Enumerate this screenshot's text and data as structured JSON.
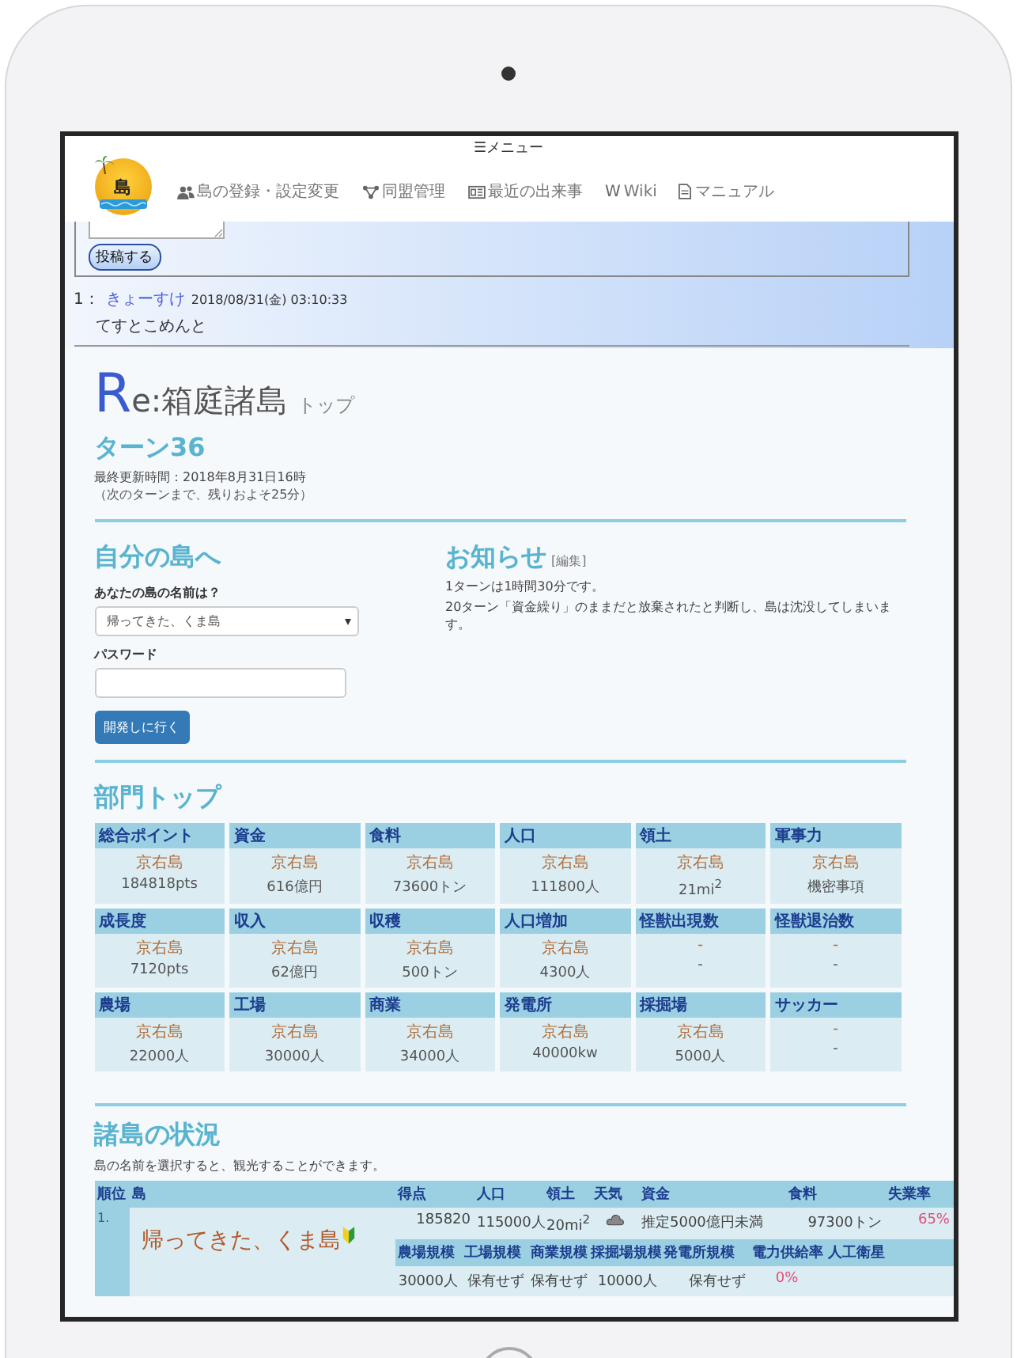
{
  "menu": {
    "icon": "☰",
    "label": "メニュー"
  },
  "logo": {
    "text": "島"
  },
  "nav": [
    {
      "kind": "users",
      "label": "島の登録・設定変更"
    },
    {
      "kind": "nodes",
      "label": "同盟管理"
    },
    {
      "kind": "news",
      "label": "最近の出来事"
    },
    {
      "kind": "letter",
      "glyph": "W",
      "label": "Wiki"
    },
    {
      "kind": "document",
      "label": "マニュアル"
    }
  ],
  "board": {
    "post_button": "投稿する",
    "comments": [
      {
        "number": "1：",
        "author": "きょーすけ",
        "date": "2018/08/31(金) 03:10:33",
        "text": "てすとこめんと"
      }
    ]
  },
  "title": {
    "initial": "R",
    "rest": "e:箱庭諸島",
    "sub": "トップ"
  },
  "turn": {
    "heading": "ターン36",
    "updated": "最終更新時間：2018年8月31日16時",
    "next": "（次のターンまで、残りおよそ25分）"
  },
  "login": {
    "heading": "自分の島へ",
    "name_label": "あなたの島の名前は？",
    "island_select": "帰ってきた、くま島",
    "password_label": "パスワード",
    "submit": "開発しに行く"
  },
  "notice": {
    "heading": "お知らせ",
    "edit_link": "[編集]",
    "lines": [
      "1ターンは1時間30分です。",
      "20ターン「資金繰り」のままだと放棄されたと判断し、島は沈没してしまいます。"
    ]
  },
  "ranking": {
    "heading": "部門トップ",
    "cards": [
      {
        "title": "総合ポイント",
        "island": "京右島",
        "value": "184818pts"
      },
      {
        "title": "資金",
        "island": "京右島",
        "value": "616億円"
      },
      {
        "title": "食料",
        "island": "京右島",
        "value": "73600トン"
      },
      {
        "title": "人口",
        "island": "京右島",
        "value": "111800人"
      },
      {
        "title": "領土",
        "island": "京右島",
        "value": "21mi$^{2}$"
      },
      {
        "title": "軍事力",
        "island": "京右島",
        "value": "機密事項"
      },
      {
        "title": "成長度",
        "island": "京右島",
        "value": "7120pts"
      },
      {
        "title": "収入",
        "island": "京右島",
        "value": "62億円"
      },
      {
        "title": "収穫",
        "island": "京右島",
        "value": "500トン"
      },
      {
        "title": "人口増加",
        "island": "京右島",
        "value": "4300人"
      },
      {
        "title": "怪獣出現数",
        "island": "-",
        "value": "-"
      },
      {
        "title": "怪獣退治数",
        "island": "-",
        "value": "-"
      },
      {
        "title": "農場",
        "island": "京右島",
        "value": "22000人"
      },
      {
        "title": "工場",
        "island": "京右島",
        "value": "30000人"
      },
      {
        "title": "商業",
        "island": "京右島",
        "value": "34000人"
      },
      {
        "title": "発電所",
        "island": "京右島",
        "value": "40000kw"
      },
      {
        "title": "採掘場",
        "island": "京右島",
        "value": "5000人"
      },
      {
        "title": "サッカー",
        "island": "-",
        "value": "-"
      }
    ]
  },
  "islands": {
    "heading": "諸島の状況",
    "hint": "島の名前を選択すると、観光することができます。",
    "columns": [
      "順位",
      "島",
      "得点",
      "人口",
      "領土",
      "天気",
      "資金",
      "食料",
      "失業率"
    ],
    "sub_columns": [
      "農場規模",
      "工場規模",
      "商業規模",
      "採掘場規模",
      "発電所規模",
      "電力供給率",
      "人工衛星"
    ],
    "rows": [
      {
        "rank": "1.",
        "name": "帰ってきた、くま島",
        "beginner": true,
        "score": "185820",
        "population": "115000人",
        "area": "20mi$^{2}$",
        "weather": {
          "kind": "cloudy"
        },
        "funds": "推定5000億円未満",
        "food": "97300トン",
        "unemployment": "65%",
        "sub_values": [
          "30000人",
          "保有せず",
          "保有せず",
          "10000人",
          "保有せず",
          "0%"
        ]
      }
    ]
  }
}
